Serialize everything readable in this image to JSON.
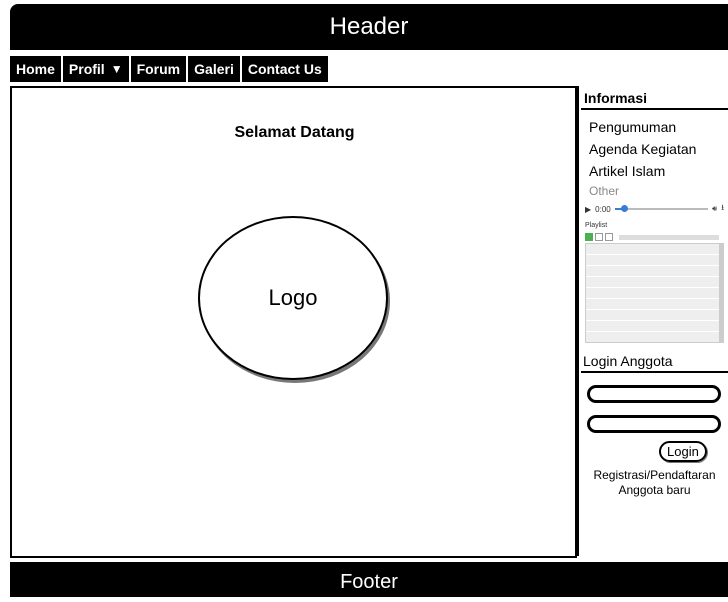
{
  "header": {
    "title": "Header"
  },
  "nav": [
    {
      "label": "Home"
    },
    {
      "label": "Profil",
      "has_dropdown": true
    },
    {
      "label": "Forum"
    },
    {
      "label": "Galeri"
    },
    {
      "label": "Contact Us"
    }
  ],
  "main": {
    "welcome": "Selamat Datang",
    "logo": "Logo"
  },
  "sidebar": {
    "info_title": "Informasi",
    "links": [
      "Pengumuman",
      "Agenda Kegiatan",
      "Artikel Islam"
    ],
    "other": "Other",
    "player": {
      "time": "0:00",
      "playlist_label": "Playlist",
      "track_count": 10
    },
    "login_title": "Login Anggota",
    "login_button": "Login",
    "register_line1": "Registrasi/Pendaftaran",
    "register_line2": "Anggota baru"
  },
  "footer": {
    "title": "Footer"
  }
}
